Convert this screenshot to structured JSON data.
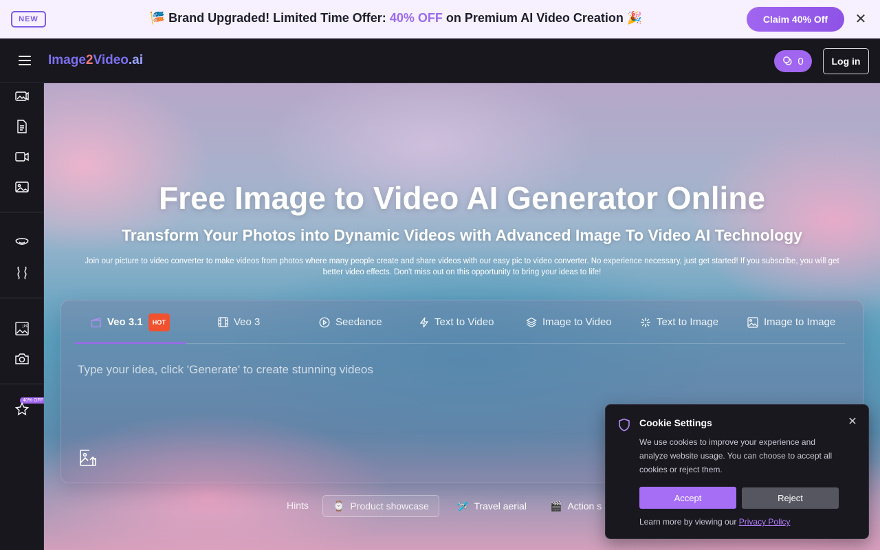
{
  "promo": {
    "badge": "NEW",
    "emoji_left": "🎏",
    "text_before": "Brand Upgraded! Limited Time Offer: ",
    "highlight": "40% OFF",
    "text_after": " on Premium AI Video Creation ",
    "emoji_right": "🎉",
    "claim_label": "Claim 40% Off",
    "close_glyph": "✕"
  },
  "header": {
    "logo": {
      "part1": "Image",
      "part2": "2",
      "part3": "Video",
      "part4": ".ai"
    },
    "credits": "0",
    "login_label": "Log in"
  },
  "sidebar": {
    "icons": [
      "image-video-icon",
      "document-icon",
      "video-camera-icon",
      "image-icon",
      "face-icon",
      "effects-icon",
      "jpg-image-icon",
      "camera-icon",
      "star-icon"
    ],
    "badge": "40% OFF"
  },
  "hero": {
    "title": "Free Image to Video AI Generator Online",
    "subtitle": "Transform Your Photos into Dynamic Videos with Advanced Image To Video AI Technology",
    "description": "Join our picture to video converter to make videos from photos where many people create and share videos with our easy pic to video converter. No experience necessary, just get started! If you subscribe, you will get better video effects. Don't miss out on this opportunity to bring your ideas to life!"
  },
  "generator": {
    "tabs": [
      {
        "label": "Veo 3.1",
        "badge": "HOT",
        "active": true
      },
      {
        "label": "Veo 3"
      },
      {
        "label": "Seedance"
      },
      {
        "label": "Text to Video"
      },
      {
        "label": "Image to Video"
      },
      {
        "label": "Text to Image"
      },
      {
        "label": "Image to Image"
      }
    ],
    "prompt_placeholder": "Type your idea, click 'Generate' to create stunning videos"
  },
  "hints": {
    "label": "Hints",
    "items": [
      {
        "emoji": "⌚",
        "label": "Product showcase"
      },
      {
        "emoji": "🛩️",
        "label": "Travel aerial"
      },
      {
        "emoji": "🎬",
        "label": "Action s"
      }
    ]
  },
  "cookie": {
    "title": "Cookie Settings",
    "text": "We use cookies to improve your experience and analyze website usage. You can choose to accept all cookies or reject them.",
    "accept_label": "Accept",
    "reject_label": "Reject",
    "learn_text": "Learn more by viewing our ",
    "policy_link": "Privacy Policy",
    "close_glyph": "✕"
  },
  "colors": {
    "accent": "#a166f0",
    "hot": "#f0522f",
    "dark_bg": "#18171e"
  }
}
